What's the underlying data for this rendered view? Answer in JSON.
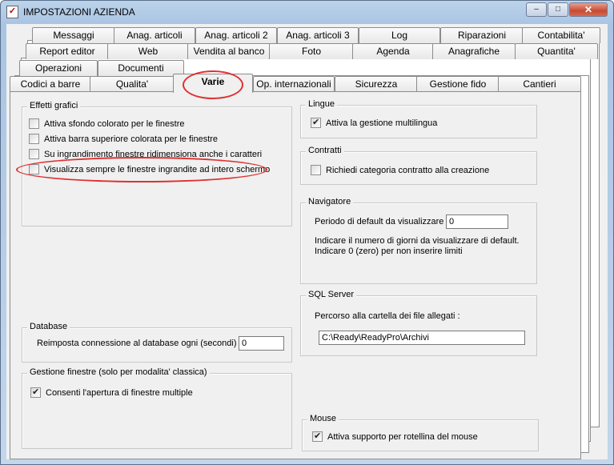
{
  "window": {
    "title": "IMPOSTAZIONI AZIENDA"
  },
  "title_controls": {
    "minimize": "‒",
    "maximize": "□",
    "close": "✕"
  },
  "tabs": {
    "row1": [
      "Messaggi",
      "Anag. articoli",
      "Anag. articoli 2",
      "Anag. articoli 3",
      "Log",
      "Riparazioni",
      "Contabilita'"
    ],
    "row2": [
      "Report editor",
      "Web",
      "Vendita al banco",
      "Foto",
      "Agenda",
      "Anagrafiche",
      "Quantita'"
    ],
    "row3": [
      "Operazioni",
      "Documenti"
    ],
    "row4": [
      "Codici a barre",
      "Qualita'",
      "Varie",
      "Op. internazionali",
      "Sicurezza",
      "Gestione fido",
      "Cantieri"
    ],
    "active": "Varie"
  },
  "effetti_grafici": {
    "label": "Effetti grafici",
    "items": [
      {
        "label": "Attiva sfondo colorato per le finestre",
        "checked": false
      },
      {
        "label": "Attiva barra superiore colorata per le finestre",
        "checked": false
      },
      {
        "label": "Su ingrandimento finestre ridimensiona anche i caratteri",
        "checked": false
      },
      {
        "label": "Visualizza sempre le finestre ingrandite ad intero schermo",
        "checked": false
      }
    ]
  },
  "database": {
    "label": "Database",
    "reconnect_label": "Reimposta connessione al database ogni (secondi) :",
    "reconnect_value": "0"
  },
  "gestione_finestre": {
    "label": "Gestione finestre (solo per modalita' classica)",
    "multiple_label": "Consenti l'apertura di finestre multiple",
    "multiple_checked": true
  },
  "lingue": {
    "label": "Lingue",
    "multilang_label": "Attiva la gestione multilingua",
    "multilang_checked": true
  },
  "contratti": {
    "label": "Contratti",
    "category_label": "Richiedi categoria contratto alla creazione",
    "category_checked": false
  },
  "navigatore": {
    "label": "Navigatore",
    "period_label": "Periodo di default da visualizzare :",
    "period_value": "0",
    "hint_line1": "Indicare il numero di giorni da visualizzare di default.",
    "hint_line2": "Indicare 0 (zero) per non inserire limiti"
  },
  "sql_server": {
    "label": "SQL Server",
    "path_label": "Percorso alla cartella dei file allegati :",
    "path_value": "C:\\Ready\\ReadyPro\\Archivi"
  },
  "mouse": {
    "label": "Mouse",
    "wheel_label": "Attiva supporto per rotellina del mouse",
    "wheel_checked": true
  },
  "colors": {
    "highlight": "#e03030",
    "panel": "#f0f0f0"
  }
}
